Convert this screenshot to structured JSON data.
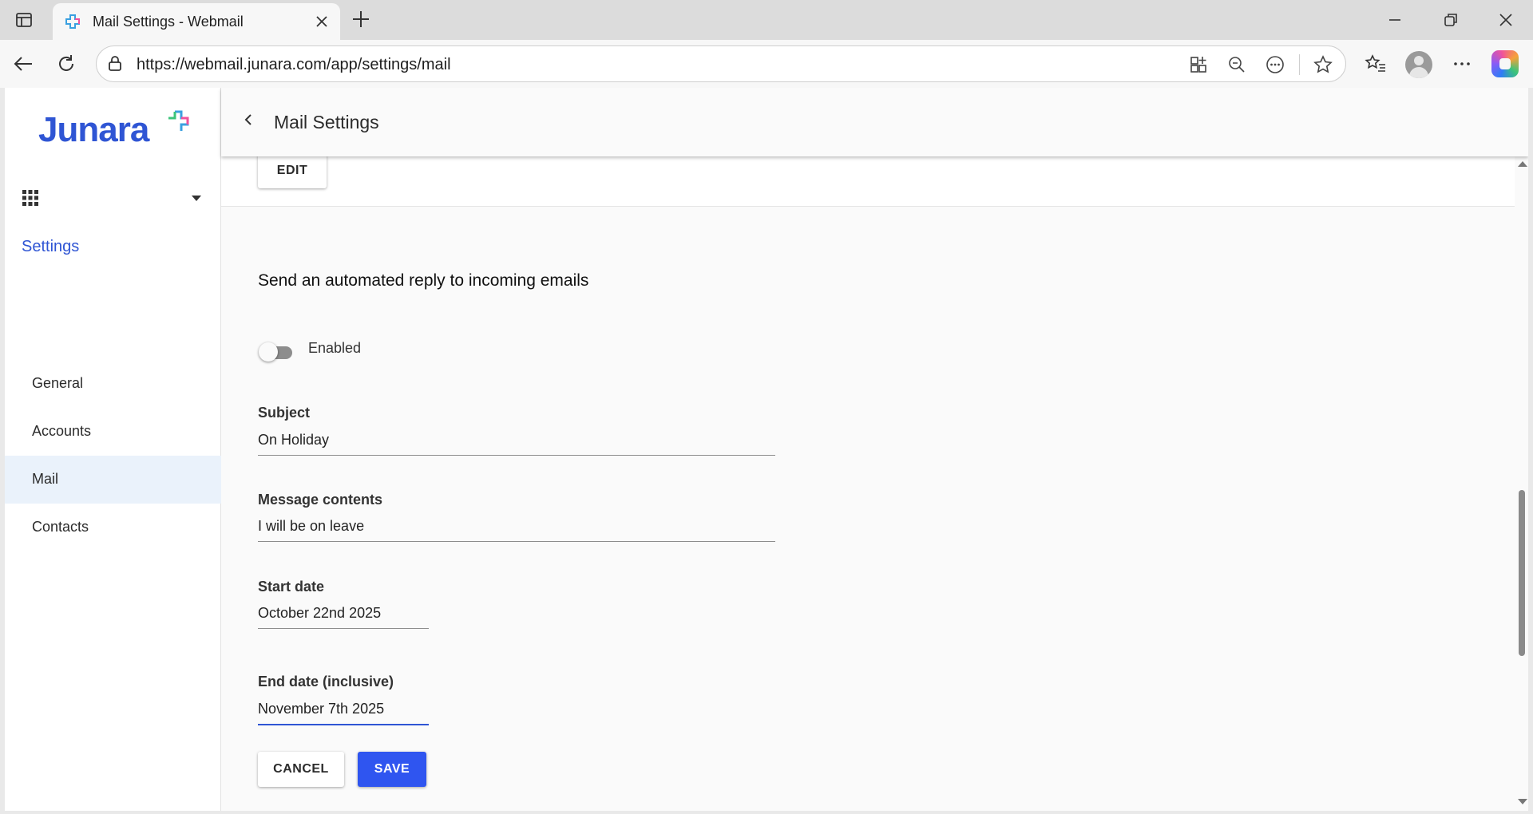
{
  "browser": {
    "tab_title": "Mail Settings - Webmail",
    "url": "https://webmail.junara.com/app/settings/mail"
  },
  "app": {
    "logo_text": "Junara",
    "nav_heading": "Settings",
    "nav_items": [
      {
        "label": "General",
        "active": false
      },
      {
        "label": "Accounts",
        "active": false
      },
      {
        "label": "Mail",
        "active": true
      },
      {
        "label": "Contacts",
        "active": false
      }
    ]
  },
  "header": {
    "title": "Mail Settings"
  },
  "previous_section": {
    "edit_label": "EDIT"
  },
  "auto_reply": {
    "title": "Send an automated reply to incoming emails",
    "toggle_label": "Enabled",
    "toggle_on": false,
    "subject_label": "Subject",
    "subject_value": "On Holiday",
    "message_label": "Message contents",
    "message_value": "I will be on leave",
    "start_label": "Start date",
    "start_value": "October 22nd 2025",
    "end_label": "End date (inclusive)",
    "end_value": "November 7th 2025",
    "cancel_label": "CANCEL",
    "save_label": "SAVE"
  },
  "colors": {
    "brand": "#2f55d4",
    "primary_button": "#2f55f0",
    "active_nav_bg": "#eaf2fb"
  }
}
